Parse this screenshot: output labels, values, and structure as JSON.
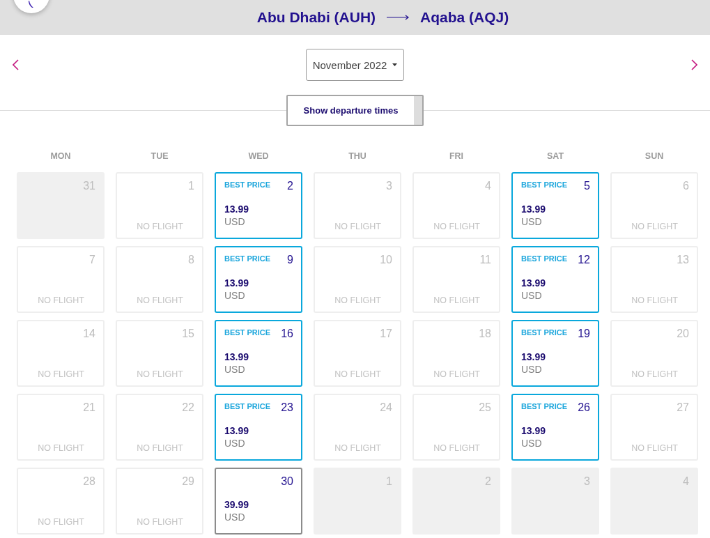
{
  "header": {
    "origin": "Abu Dhabi (AUH)",
    "destination": "Aqaba (AQJ)"
  },
  "month_picker": {
    "value": "November 2022"
  },
  "departure_times_button": {
    "label": "Show departure times"
  },
  "weekdays": [
    "MON",
    "TUE",
    "WED",
    "THU",
    "FRI",
    "SAT",
    "SUN"
  ],
  "weeks": [
    [
      {
        "kind": "outside",
        "day": "31"
      },
      {
        "kind": "no_flight",
        "day": "1",
        "note": "NO FLIGHT"
      },
      {
        "kind": "fare",
        "day": "2",
        "best_price": true,
        "badge": "BEST PRICE",
        "price": "13.99",
        "currency": "USD"
      },
      {
        "kind": "no_flight",
        "day": "3",
        "note": "NO FLIGHT"
      },
      {
        "kind": "no_flight",
        "day": "4",
        "note": "NO FLIGHT"
      },
      {
        "kind": "fare",
        "day": "5",
        "best_price": true,
        "badge": "BEST PRICE",
        "price": "13.99",
        "currency": "USD"
      },
      {
        "kind": "no_flight",
        "day": "6",
        "note": "NO FLIGHT"
      }
    ],
    [
      {
        "kind": "no_flight",
        "day": "7",
        "note": "NO FLIGHT"
      },
      {
        "kind": "no_flight",
        "day": "8",
        "note": "NO FLIGHT"
      },
      {
        "kind": "fare",
        "day": "9",
        "best_price": true,
        "badge": "BEST PRICE",
        "price": "13.99",
        "currency": "USD"
      },
      {
        "kind": "no_flight",
        "day": "10",
        "note": "NO FLIGHT"
      },
      {
        "kind": "no_flight",
        "day": "11",
        "note": "NO FLIGHT"
      },
      {
        "kind": "fare",
        "day": "12",
        "best_price": true,
        "badge": "BEST PRICE",
        "price": "13.99",
        "currency": "USD"
      },
      {
        "kind": "no_flight",
        "day": "13",
        "note": "NO FLIGHT"
      }
    ],
    [
      {
        "kind": "no_flight",
        "day": "14",
        "note": "NO FLIGHT"
      },
      {
        "kind": "no_flight",
        "day": "15",
        "note": "NO FLIGHT"
      },
      {
        "kind": "fare",
        "day": "16",
        "best_price": true,
        "badge": "BEST PRICE",
        "price": "13.99",
        "currency": "USD"
      },
      {
        "kind": "no_flight",
        "day": "17",
        "note": "NO FLIGHT"
      },
      {
        "kind": "no_flight",
        "day": "18",
        "note": "NO FLIGHT"
      },
      {
        "kind": "fare",
        "day": "19",
        "best_price": true,
        "badge": "BEST PRICE",
        "price": "13.99",
        "currency": "USD"
      },
      {
        "kind": "no_flight",
        "day": "20",
        "note": "NO FLIGHT"
      }
    ],
    [
      {
        "kind": "no_flight",
        "day": "21",
        "note": "NO FLIGHT"
      },
      {
        "kind": "no_flight",
        "day": "22",
        "note": "NO FLIGHT"
      },
      {
        "kind": "fare",
        "day": "23",
        "best_price": true,
        "badge": "BEST PRICE",
        "price": "13.99",
        "currency": "USD"
      },
      {
        "kind": "no_flight",
        "day": "24",
        "note": "NO FLIGHT"
      },
      {
        "kind": "no_flight",
        "day": "25",
        "note": "NO FLIGHT"
      },
      {
        "kind": "fare",
        "day": "26",
        "best_price": true,
        "badge": "BEST PRICE",
        "price": "13.99",
        "currency": "USD"
      },
      {
        "kind": "no_flight",
        "day": "27",
        "note": "NO FLIGHT"
      }
    ],
    [
      {
        "kind": "no_flight",
        "day": "28",
        "note": "NO FLIGHT"
      },
      {
        "kind": "no_flight",
        "day": "29",
        "note": "NO FLIGHT"
      },
      {
        "kind": "fare",
        "day": "30",
        "best_price": false,
        "price": "39.99",
        "currency": "USD"
      },
      {
        "kind": "outside",
        "day": "1"
      },
      {
        "kind": "outside",
        "day": "2"
      },
      {
        "kind": "outside",
        "day": "3"
      },
      {
        "kind": "outside",
        "day": "4"
      }
    ]
  ]
}
